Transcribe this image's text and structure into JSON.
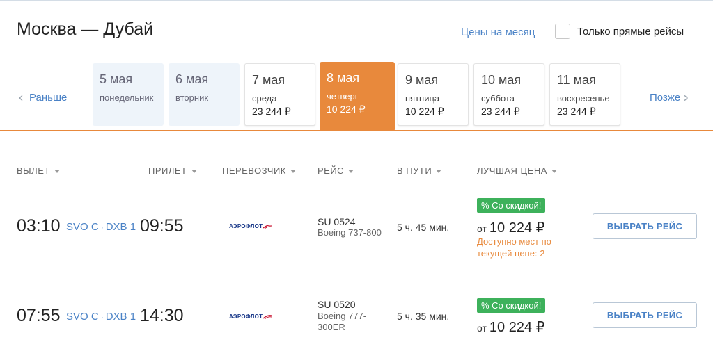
{
  "header": {
    "route_title": "Москва — Дубай",
    "month_prices_link": "Цены на месяц",
    "direct_only_label": "Только прямые рейсы",
    "direct_only_checked": false
  },
  "date_nav": {
    "prev_label": "Раньше",
    "next_label": "Позже",
    "days": [
      {
        "date": "5 мая",
        "weekday": "понедельник",
        "price": ""
      },
      {
        "date": "6 мая",
        "weekday": "вторник",
        "price": ""
      },
      {
        "date": "7 мая",
        "weekday": "среда",
        "price": "23 244 ₽"
      },
      {
        "date": "8 мая",
        "weekday": "четверг",
        "price": "10 224 ₽"
      },
      {
        "date": "9 мая",
        "weekday": "пятница",
        "price": "10 224 ₽"
      },
      {
        "date": "10 мая",
        "weekday": "суббота",
        "price": "23 244 ₽"
      },
      {
        "date": "11 мая",
        "weekday": "воскресенье",
        "price": "23 244 ₽"
      }
    ],
    "selected_index": 3
  },
  "columns": {
    "departure": "ВЫЛЕТ",
    "arrival": "ПРИЛЕТ",
    "carrier": "ПЕРЕВОЗЧИК",
    "flight": "РЕЙС",
    "duration": "В ПУТИ",
    "best_price": "ЛУЧШАЯ ЦЕНА"
  },
  "flights": [
    {
      "departure_time": "03:10",
      "from_airport": "SVO C",
      "to_airport": "DXB 1",
      "arrival_time": "09:55",
      "carrier_logo_text": "АЭРОФЛОТ",
      "flight_number": "SU 0524",
      "aircraft": "Boeing 737-800",
      "duration": "5 ч. 45 мин.",
      "discount_badge": "% Со скидкой!",
      "price_prefix": "от",
      "price": "10 224 ₽",
      "availability_note": "Доступно мест по текущей цене: 2",
      "select_button": "ВЫБРАТЬ РЕЙС"
    },
    {
      "departure_time": "07:55",
      "from_airport": "SVO C",
      "to_airport": "DXB 1",
      "arrival_time": "14:30",
      "carrier_logo_text": "АЭРОФЛОТ",
      "flight_number": "SU 0520",
      "aircraft": "Boeing 777-300ER",
      "duration": "5 ч. 35 мин.",
      "discount_badge": "% Со скидкой!",
      "price_prefix": "от",
      "price": "10 224 ₽",
      "availability_note": "",
      "select_button": "ВЫБРАТЬ РЕЙС"
    }
  ],
  "colors": {
    "accent_orange": "#e8893c",
    "link_blue": "#4a82c6",
    "discount_green": "#3db15b",
    "empty_day_bg": "#eef4fa"
  }
}
